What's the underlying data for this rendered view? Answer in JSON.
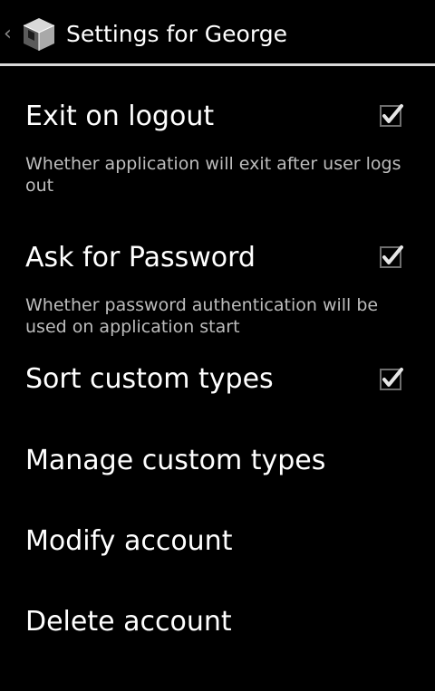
{
  "action_bar": {
    "title": "Settings for George",
    "icon": "cube-icon",
    "back_icon": "chevron-left-icon"
  },
  "preferences": [
    {
      "title": "Exit on logout",
      "summary": "Whether application will exit after user logs out",
      "checked": true
    },
    {
      "title": "Ask for Password",
      "summary": "Whether password authentication will be used on application start",
      "checked": true
    },
    {
      "title": "Sort custom types",
      "checked": true
    },
    {
      "title": "Manage custom types"
    },
    {
      "title": "Modify account"
    },
    {
      "title": "Delete account"
    }
  ],
  "colors": {
    "background": "#000000",
    "divider": "#d9d9d9",
    "title_text": "#ffffff",
    "summary_text": "#bdbdbd",
    "checkmark": "#e6e6e6"
  }
}
